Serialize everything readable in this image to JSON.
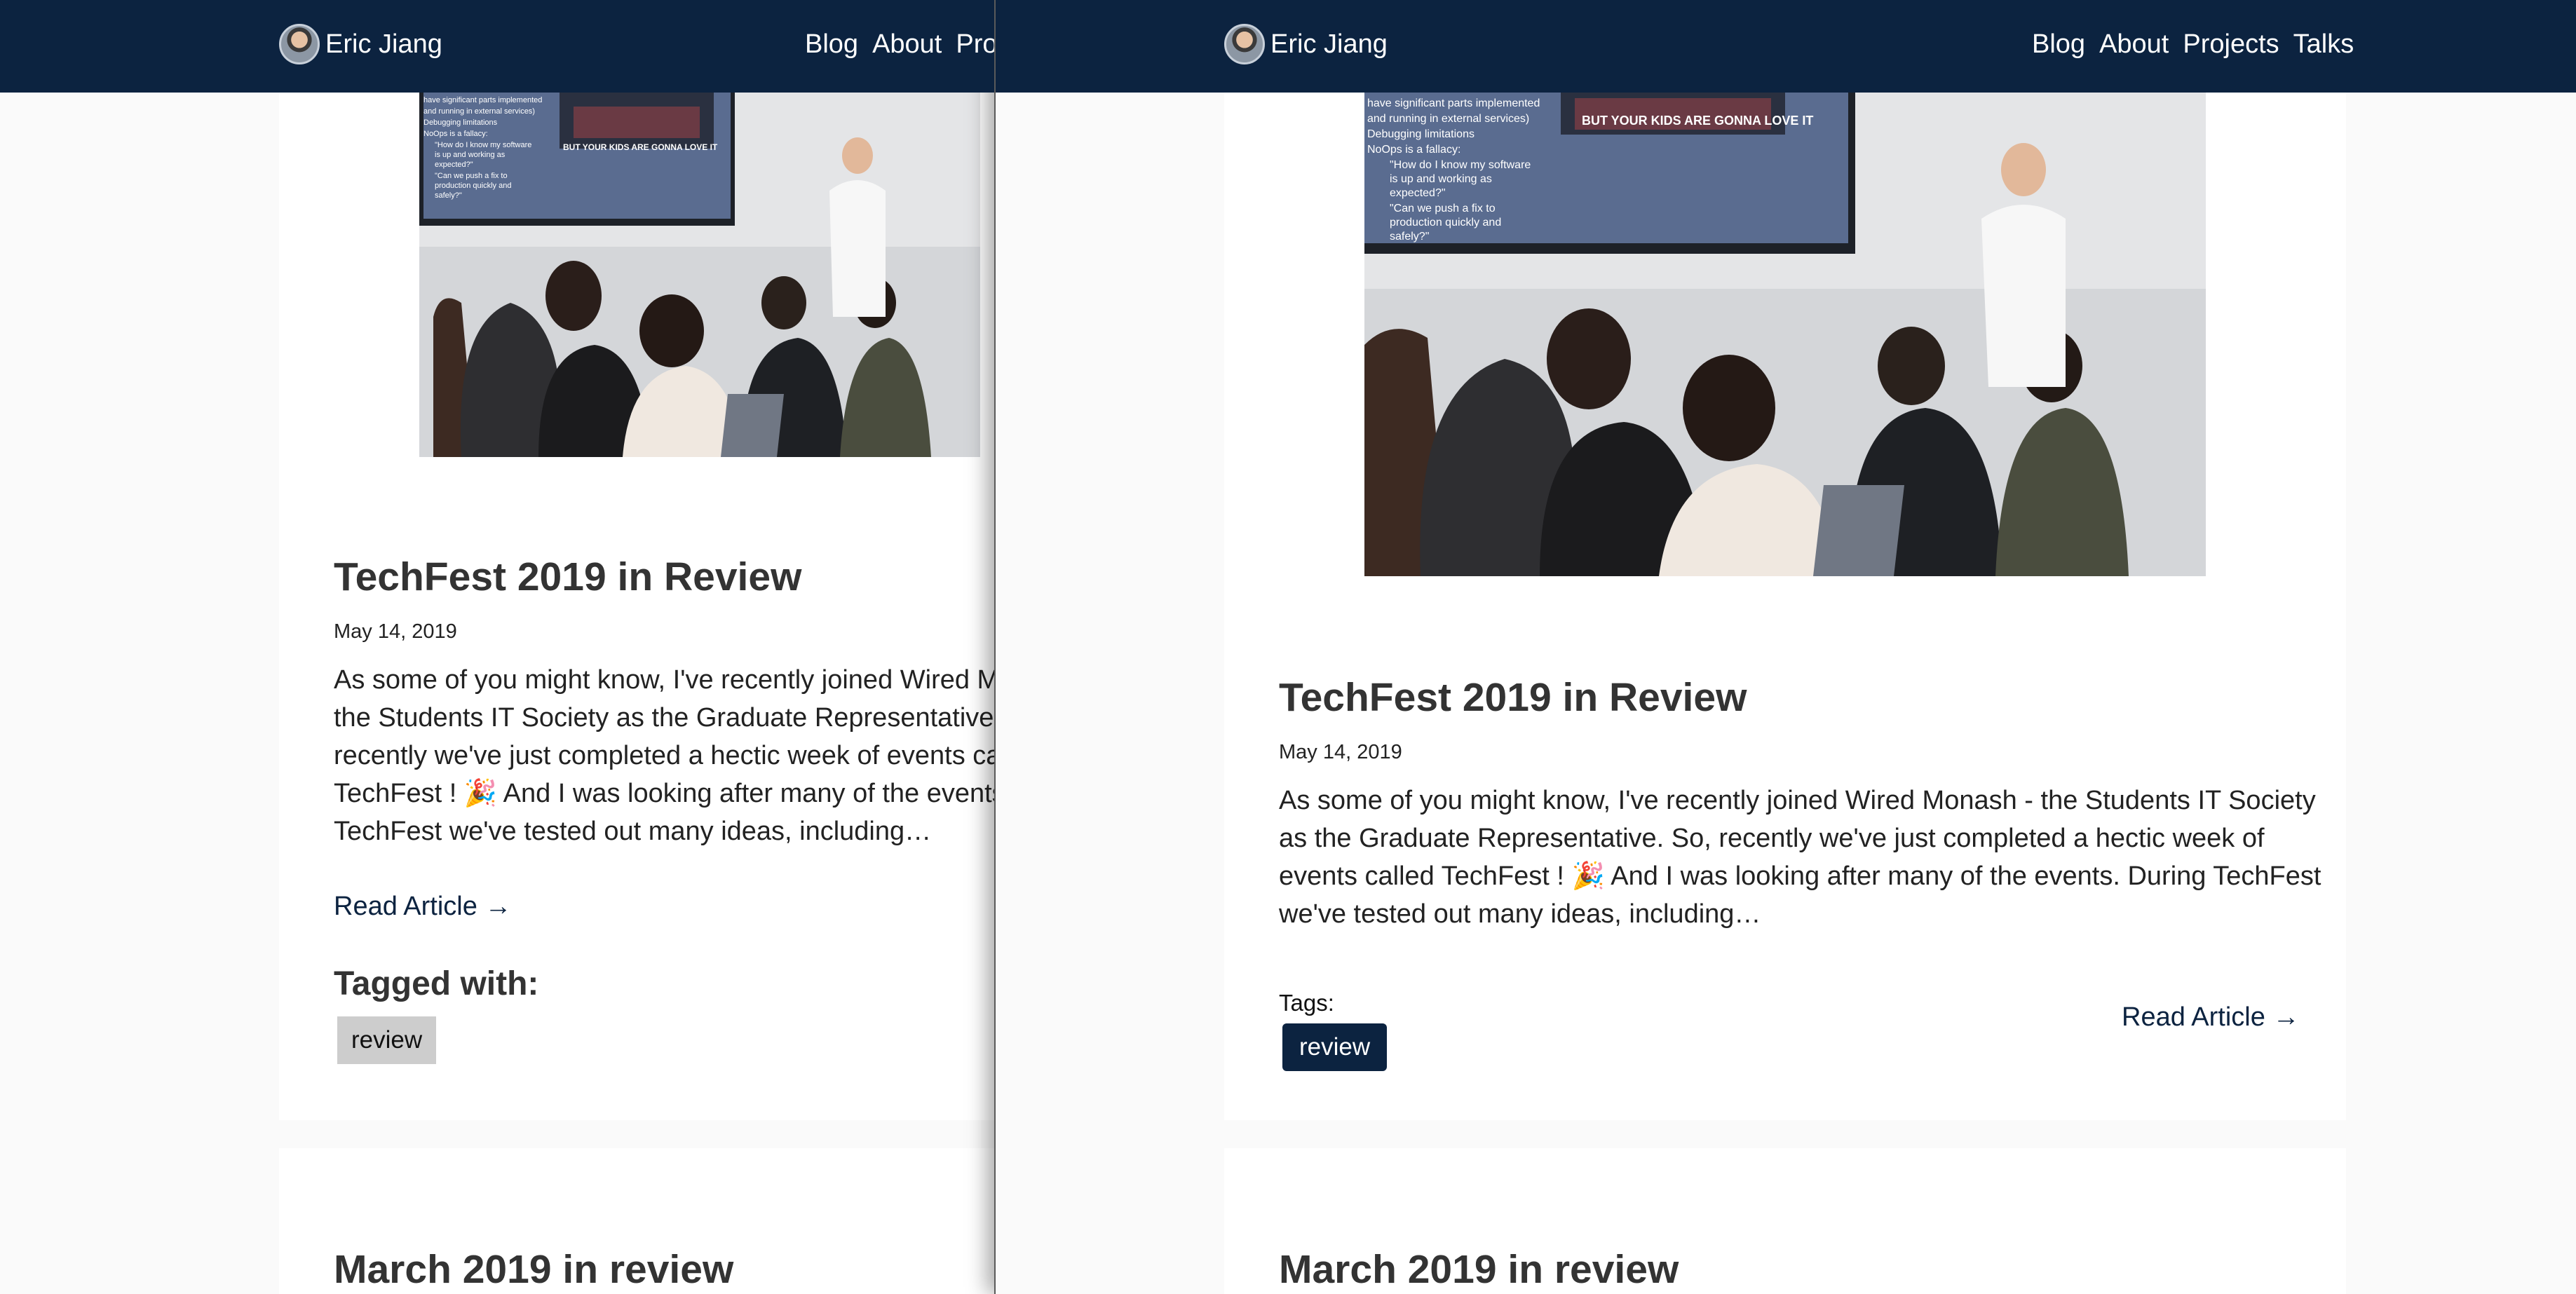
{
  "site": {
    "owner_name": "Eric Jiang",
    "nav": {
      "blog": "Blog",
      "about": "About",
      "projects": "Projects",
      "projects_clipped": "Proj",
      "talks": "Talks"
    }
  },
  "post": {
    "title": "TechFest 2019 in Review",
    "date": "May 14, 2019",
    "excerpt": "As some of you might know, I've recently joined Wired Monash - the Students IT Society as the Graduate Representative. So, recently we've just completed a hectic week of events called TechFest ! 🎉 And I was looking after many of the events. During TechFest we've tested out many ideas, including…",
    "read_more": "Read Article →",
    "tag": "review"
  },
  "left_version": {
    "excerpt_lines": [
      "As some of you might know, I've recently joined Wired Mon",
      "the Students IT Society as the Graduate Representative. S",
      "recently we've just completed a hectic week of events calle",
      "TechFest ! 🎉 And I was looking after many of the events. D",
      "TechFest we've tested out many ideas, including…"
    ],
    "tagged_heading": "Tagged with:"
  },
  "right_version": {
    "excerpt_lines": [
      "As some of you might know, I've recently joined Wired Monash - the Students IT Society",
      "as the Graduate Representative. So, recently we've just completed a hectic week of",
      "events called TechFest ! 🎉 And I was looking after many of the events. During TechFest",
      "we've tested out many ideas, including…"
    ],
    "tags_label": "Tags:"
  },
  "next_post": {
    "title": "March 2019 in review"
  },
  "hero_image": {
    "slide_lines": [
      "have significant parts implemented",
      "and running in external services)",
      "Debugging limitations",
      "NoOps is a fallacy:",
      "\"How do I know my software",
      "is up and working as",
      "expected?\"",
      "\"Can we push a fix to",
      "production quickly and",
      "safely?\""
    ],
    "video_caption": "BUT YOUR KIDS ARE GONNA LOVE IT"
  },
  "colors": {
    "nav_bg": "#0c2340",
    "page_bg": "#fafafa",
    "card_bg": "#ffffff",
    "tag_grey": "#cdcdcd",
    "tag_blue": "#0c2340"
  }
}
